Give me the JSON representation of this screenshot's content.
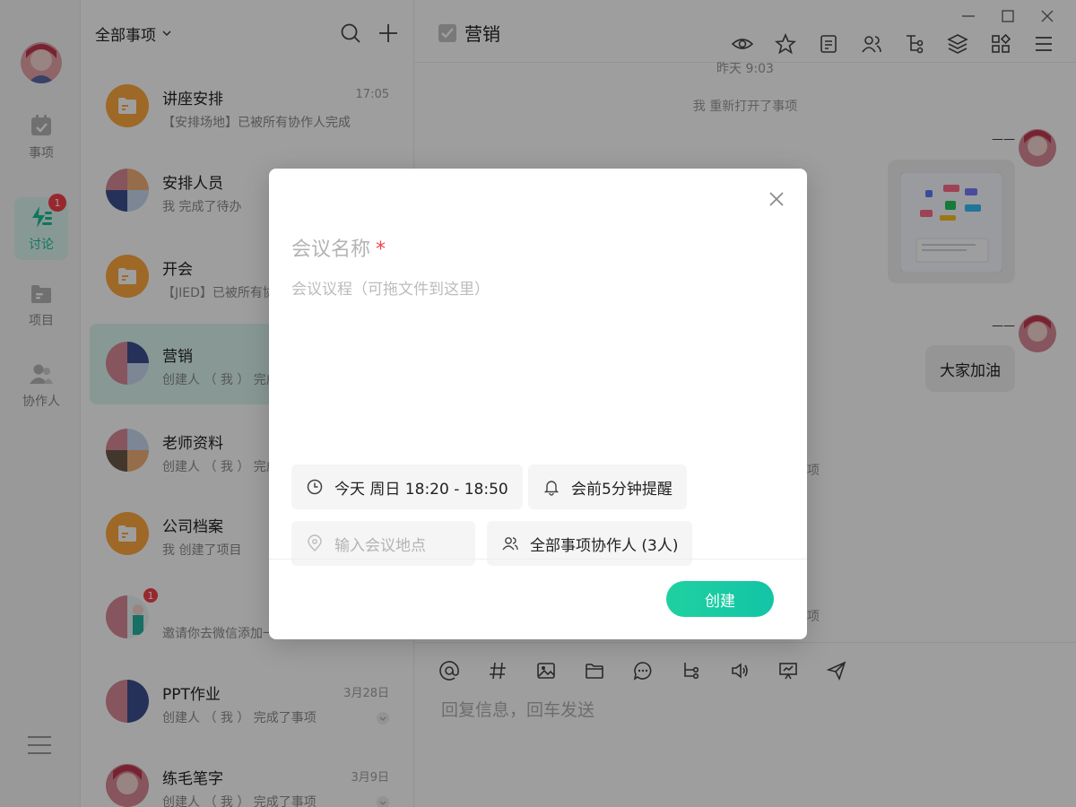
{
  "nav": {
    "items": [
      {
        "label": "事项"
      },
      {
        "label": "讨论",
        "badge": "1"
      },
      {
        "label": "项目"
      },
      {
        "label": "协作人"
      }
    ]
  },
  "list": {
    "filter_label": "全部事项",
    "rows": [
      {
        "name": "讲座安排",
        "sub": "【安排场地】已被所有协作人完成",
        "time": "17:05"
      },
      {
        "name": "安排人员",
        "sub": "我 完成了待办",
        "time": ""
      },
      {
        "name": "开会",
        "sub": "【JIED】已被所有协作人完成",
        "time": ""
      },
      {
        "name": "营销",
        "sub": "创建人 （ 我 ） 完成了事项",
        "time": ""
      },
      {
        "name": "老师资料",
        "sub": "创建人 （ 我 ） 完成了事项",
        "time": ""
      },
      {
        "name": "公司档案",
        "sub": "我 创建了项目",
        "time": ""
      },
      {
        "name": "",
        "sub": "邀请你去微信添加一个企业员工",
        "time": "",
        "badge": "1"
      },
      {
        "name": "PPT作业",
        "sub": "创建人 （ 我 ） 完成了事项",
        "time": "3月28日"
      },
      {
        "name": "练毛笔字",
        "sub": "创建人 （ 我 ） 完成了事项",
        "time": "3月9日"
      }
    ]
  },
  "chat": {
    "title": "营销",
    "note_time": "昨天 9:03",
    "note_reopen": "我 重新打开了事项",
    "sender_name_1": "——",
    "sender_name_2": "——",
    "message_text": "大家加油",
    "partial_note_1": "项",
    "partial_note_2": "项",
    "composer_placeholder": "回复信息，回车发送"
  },
  "modal": {
    "name_placeholder": "会议名称",
    "required_mark": "*",
    "agenda_placeholder": "会议议程（可拖文件到这里）",
    "time_chip": "今天 周日 18:20 - 18:50",
    "reminder_chip": "会前5分钟提醒",
    "location_placeholder": "输入会议地点",
    "members_chip": "全部事项协作人 (3人)",
    "create_label": "创建"
  },
  "colors": {
    "accent": "#1bbf96",
    "active_bg": "#dcf7f1",
    "badge": "#f5424a",
    "folder": "#ffa940"
  }
}
